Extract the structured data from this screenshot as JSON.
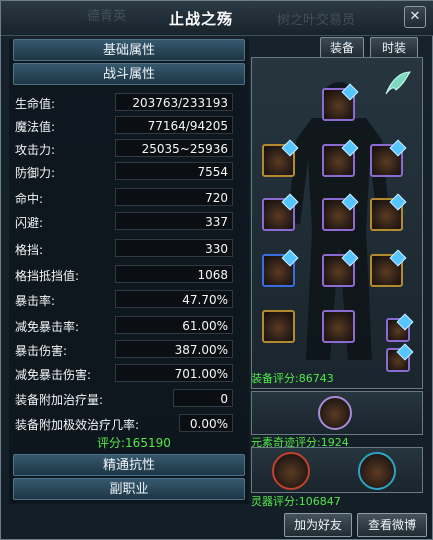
{
  "window": {
    "title": "止战之殇",
    "bg_texts": [
      "德青英",
      "树之叶交易员"
    ],
    "close_symbol": "✕"
  },
  "tabs": {
    "equipment": "装备",
    "fashion": "时装"
  },
  "sections": {
    "basic": "基础属性",
    "combat": "战斗属性",
    "mastery": "精通抗性",
    "sub_job": "副职业"
  },
  "stats": [
    {
      "label": "生命值:",
      "value": "203763/233193"
    },
    {
      "label": "魔法值:",
      "value": "77164/94205"
    },
    {
      "label": "攻击力:",
      "value": "25035~25936"
    },
    {
      "label": "防御力:",
      "value": "7554"
    },
    {
      "label": "命中:",
      "value": "720"
    },
    {
      "label": "闪避:",
      "value": "337"
    },
    {
      "label": "格挡:",
      "value": "330"
    },
    {
      "label": "格挡抵挡值:",
      "value": "1068"
    },
    {
      "label": "暴击率:",
      "value": "47.70%"
    },
    {
      "label": "减免暴击率:",
      "value": "61.00%"
    },
    {
      "label": "暴击伤害:",
      "value": "387.00%"
    },
    {
      "label": "减免暴击伤害:",
      "value": "701.00%"
    },
    {
      "label": "装备附加治疗量:",
      "value": "0"
    },
    {
      "label": "装备附加极效治疗几率:",
      "value": "0.00%"
    }
  ],
  "combat_score": "评分:165190",
  "equip_score": "装备评分:86743",
  "element_score": "元素奇迹评分:1924",
  "spirit_score": "灵器评分:106847",
  "buttons": {
    "add_friend": "加为好友",
    "view_weibo": "查看微博"
  },
  "colors": {
    "score_green": "#52e84a",
    "slot_purple": "#8a6bd1",
    "slot_gold": "#b48a2e"
  }
}
